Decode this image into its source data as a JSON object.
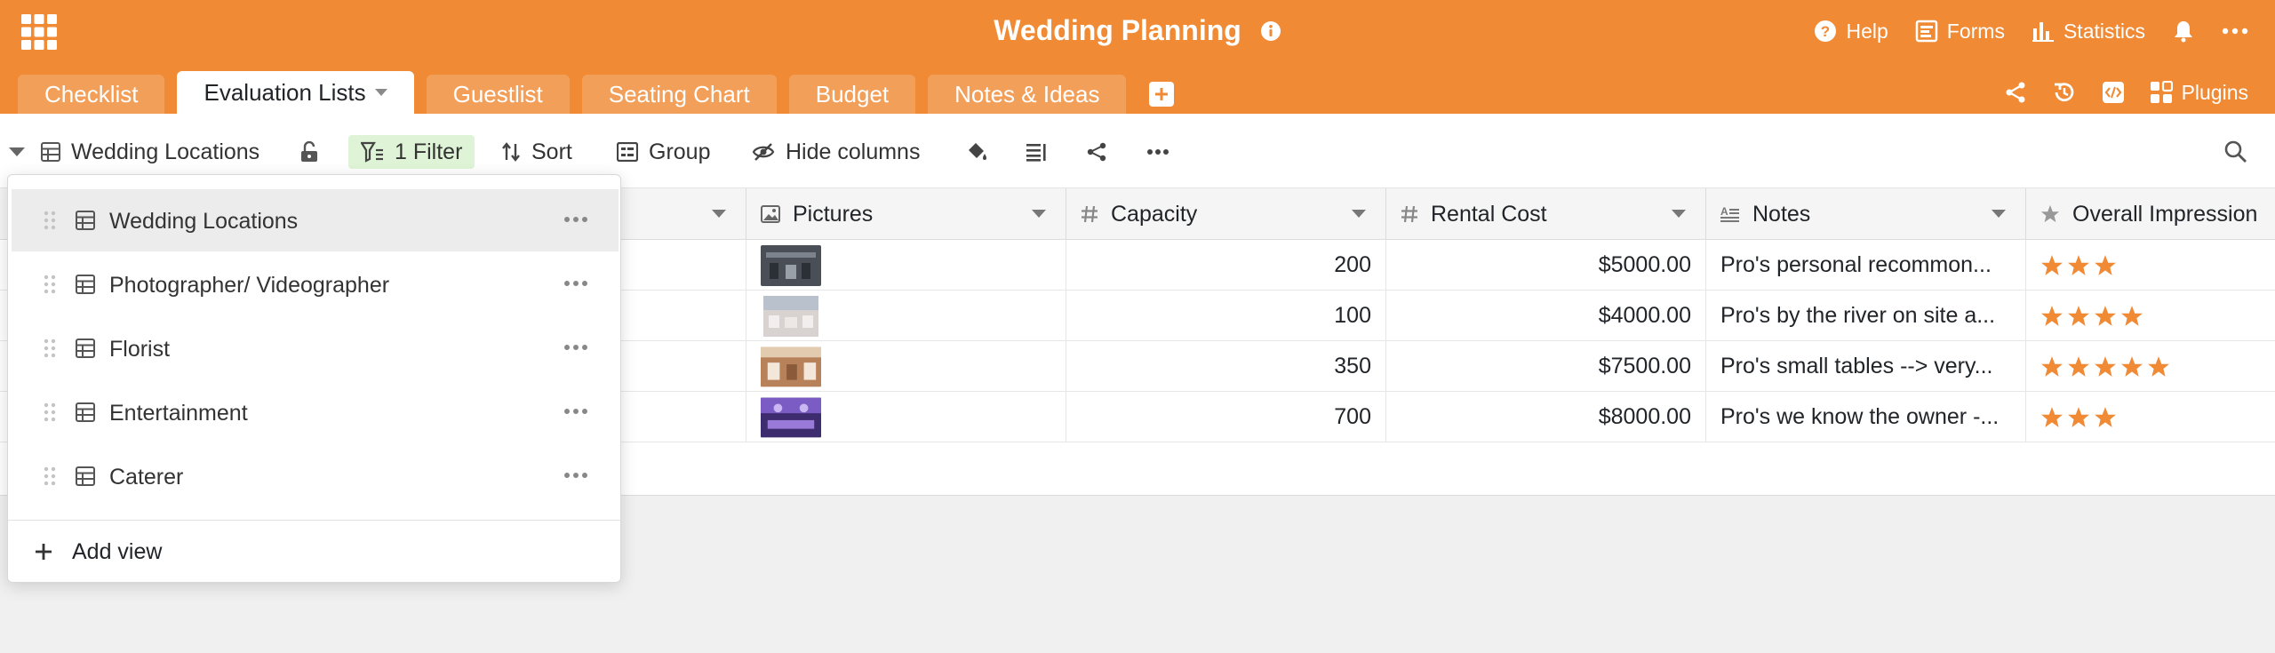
{
  "header": {
    "title": "Wedding Planning",
    "help": "Help",
    "forms": "Forms",
    "statistics": "Statistics",
    "accent": "#f08a35"
  },
  "tabs": [
    {
      "label": "Checklist"
    },
    {
      "label": "Evaluation Lists",
      "active": true
    },
    {
      "label": "Guestlist"
    },
    {
      "label": "Seating Chart"
    },
    {
      "label": "Budget"
    },
    {
      "label": "Notes & Ideas"
    }
  ],
  "tabs_right": {
    "plugins": "Plugins"
  },
  "toolbar": {
    "view_name": "Wedding Locations",
    "filter": "1 Filter",
    "sort": "Sort",
    "group": "Group",
    "hide_columns": "Hide columns"
  },
  "columns": [
    {
      "label": "Pictures",
      "icon": "image-icon"
    },
    {
      "label": "Capacity",
      "icon": "hash-icon"
    },
    {
      "label": "Rental Cost",
      "icon": "hash-icon"
    },
    {
      "label": "Notes",
      "icon": "long-text-icon"
    },
    {
      "label": "Overall Impression",
      "icon": "star-icon"
    }
  ],
  "rows": [
    {
      "thumb_color": "#4a4e57",
      "capacity": "200",
      "rental_cost": "$5000.00",
      "notes": "Pro's personal recommon...",
      "rating": 3
    },
    {
      "thumb_color": "#c9c3c2",
      "capacity": "100",
      "rental_cost": "$4000.00",
      "notes": "Pro's by the river on site a...",
      "rating": 4
    },
    {
      "thumb_color": "#b7815a",
      "capacity": "350",
      "rental_cost": "$7500.00",
      "notes": "Pro's small tables --> very...",
      "rating": 5
    },
    {
      "thumb_color": "#6a4c9c",
      "capacity": "700",
      "rental_cost": "$8000.00",
      "notes": "Pro's we know the owner -...",
      "rating": 3
    }
  ],
  "views_dropdown": {
    "items": [
      {
        "label": "Wedding Locations",
        "selected": true
      },
      {
        "label": "Photographer/ Videographer"
      },
      {
        "label": "Florist"
      },
      {
        "label": "Entertainment"
      },
      {
        "label": "Caterer"
      }
    ],
    "add_view": "Add view"
  },
  "colors": {
    "star": "#f08a35",
    "filter_bg": "#dff3d6"
  }
}
